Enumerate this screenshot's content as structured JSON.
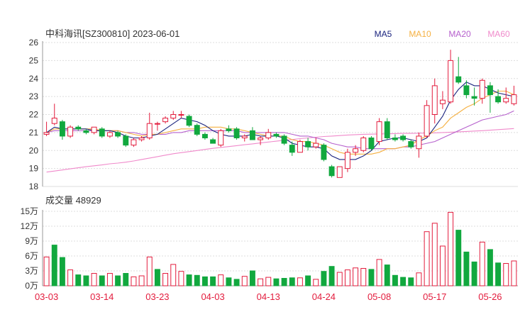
{
  "header": {
    "title": "中科海讯[SZ300810] 2023-06-01",
    "ma_legend": [
      {
        "label": "MA5",
        "color": "#1a237e"
      },
      {
        "label": "MA10",
        "color": "#f5b041"
      },
      {
        "label": "MA20",
        "color": "#b660cd"
      },
      {
        "label": "MA60",
        "color": "#f08acb"
      }
    ]
  },
  "volume_header": {
    "label": "成交量 48929"
  },
  "colors": {
    "up": "#e31c3d",
    "down": "#11a83e",
    "grid": "#dddddd",
    "axis": "#333333",
    "date_label": "#e31c3d"
  },
  "chart_data": [
    {
      "type": "candlestick",
      "title": "中科海讯[SZ300810] 2023-06-01",
      "ylim": [
        18,
        26
      ],
      "y_ticks": [
        "18",
        "19",
        "20",
        "21",
        "22",
        "23",
        "24",
        "25",
        "26"
      ],
      "x_tick_labels": [
        "03-03",
        "03-14",
        "03-23",
        "04-03",
        "04-13",
        "04-24",
        "05-08",
        "05-17",
        "05-26"
      ],
      "x_tick_indices": [
        0,
        7,
        14,
        21,
        28,
        35,
        42,
        49,
        56
      ],
      "ohlc": [
        [
          20.9,
          21.6,
          20.8,
          21.0
        ],
        [
          21.5,
          22.6,
          21.4,
          21.8
        ],
        [
          21.6,
          21.7,
          20.6,
          20.8
        ],
        [
          20.8,
          21.4,
          20.7,
          21.3
        ],
        [
          21.3,
          21.4,
          21.1,
          21.2
        ],
        [
          21.1,
          21.2,
          20.9,
          21.0
        ],
        [
          21.0,
          21.3,
          20.9,
          21.3
        ],
        [
          21.2,
          21.3,
          20.7,
          20.8
        ],
        [
          20.8,
          21.1,
          20.7,
          21.0
        ],
        [
          21.0,
          21.1,
          20.7,
          20.8
        ],
        [
          20.8,
          20.9,
          20.2,
          20.3
        ],
        [
          20.3,
          20.7,
          20.2,
          20.6
        ],
        [
          20.6,
          20.8,
          20.5,
          20.7
        ],
        [
          20.7,
          22.1,
          20.6,
          21.5
        ],
        [
          21.5,
          21.6,
          21.1,
          21.5
        ],
        [
          21.6,
          21.9,
          21.5,
          21.8
        ],
        [
          21.8,
          22.2,
          21.7,
          22.0
        ],
        [
          22.0,
          22.2,
          21.8,
          22.0
        ],
        [
          21.9,
          22.0,
          21.3,
          21.4
        ],
        [
          21.4,
          21.5,
          20.8,
          20.9
        ],
        [
          20.9,
          21.0,
          20.6,
          20.7
        ],
        [
          20.6,
          20.7,
          20.4,
          20.4
        ],
        [
          20.3,
          21.2,
          20.2,
          21.1
        ],
        [
          21.2,
          21.4,
          21.0,
          21.1
        ],
        [
          21.2,
          21.3,
          20.6,
          20.7
        ],
        [
          20.7,
          20.9,
          20.5,
          20.8
        ],
        [
          21.1,
          21.3,
          20.6,
          20.6
        ],
        [
          20.6,
          20.8,
          20.3,
          20.7
        ],
        [
          20.7,
          21.2,
          20.6,
          21.0
        ],
        [
          20.9,
          21.0,
          20.7,
          20.8
        ],
        [
          20.8,
          20.9,
          20.3,
          20.4
        ],
        [
          20.3,
          20.5,
          19.7,
          19.9
        ],
        [
          19.9,
          20.6,
          19.9,
          20.5
        ],
        [
          20.5,
          20.7,
          20.0,
          20.2
        ],
        [
          20.2,
          20.7,
          20.1,
          20.4
        ],
        [
          20.3,
          20.4,
          19.4,
          19.5
        ],
        [
          19.1,
          19.2,
          18.5,
          18.6
        ],
        [
          18.5,
          19.1,
          18.5,
          19.1
        ],
        [
          19.0,
          20.1,
          18.8,
          19.9
        ],
        [
          19.9,
          20.3,
          19.7,
          20.1
        ],
        [
          20.0,
          20.8,
          19.9,
          20.7
        ],
        [
          20.7,
          20.8,
          20.0,
          20.1
        ],
        [
          20.5,
          21.8,
          20.3,
          21.6
        ],
        [
          21.6,
          21.8,
          20.6,
          20.7
        ],
        [
          20.7,
          20.9,
          20.5,
          20.6
        ],
        [
          20.8,
          20.9,
          20.5,
          20.6
        ],
        [
          20.5,
          20.6,
          20.1,
          20.2
        ],
        [
          20.1,
          21.0,
          19.6,
          20.8
        ],
        [
          20.8,
          22.8,
          20.7,
          22.5
        ],
        [
          22.0,
          24.0,
          21.5,
          23.6
        ],
        [
          22.6,
          23.3,
          22.3,
          22.8
        ],
        [
          22.7,
          25.6,
          22.6,
          25.0
        ],
        [
          24.1,
          25.2,
          23.7,
          23.8
        ],
        [
          23.6,
          23.9,
          22.9,
          23.1
        ],
        [
          23.0,
          23.5,
          22.5,
          22.9
        ],
        [
          22.9,
          24.0,
          22.6,
          23.9
        ],
        [
          23.6,
          23.8,
          22.1,
          23.1
        ],
        [
          23.0,
          23.4,
          22.6,
          22.7
        ],
        [
          22.7,
          23.5,
          22.6,
          22.9
        ],
        [
          22.6,
          23.6,
          22.5,
          23.1
        ]
      ],
      "series": [
        {
          "name": "MA5",
          "color": "#1a237e",
          "values": [
            21.0,
            21.3,
            21.2,
            21.2,
            21.2,
            21.2,
            21.1,
            21.1,
            21.1,
            21.0,
            20.8,
            20.7,
            20.7,
            20.8,
            20.9,
            21.2,
            21.5,
            21.8,
            21.7,
            21.6,
            21.4,
            21.1,
            20.9,
            20.8,
            20.8,
            20.8,
            20.9,
            20.8,
            20.8,
            20.8,
            20.7,
            20.4,
            20.3,
            20.2,
            20.2,
            20.1,
            19.7,
            19.5,
            19.5,
            19.5,
            19.7,
            20.0,
            20.5,
            20.6,
            20.7,
            20.7,
            20.6,
            20.5,
            20.7,
            21.3,
            21.9,
            22.8,
            23.4,
            23.8,
            23.6,
            23.6,
            23.4,
            23.2,
            23.1,
            23.0
          ]
        },
        {
          "name": "MA10",
          "color": "#f5b041",
          "values": [
            21.0,
            21.2,
            21.2,
            21.2,
            21.2,
            21.2,
            21.2,
            21.1,
            21.1,
            21.1,
            21.0,
            20.9,
            20.8,
            20.9,
            20.9,
            21.0,
            21.1,
            21.2,
            21.2,
            21.2,
            21.3,
            21.3,
            21.3,
            21.2,
            21.2,
            21.1,
            21.0,
            20.9,
            20.8,
            20.8,
            20.8,
            20.6,
            20.5,
            20.5,
            20.4,
            20.3,
            20.1,
            19.9,
            19.8,
            19.8,
            19.8,
            19.8,
            19.9,
            20.1,
            20.1,
            20.2,
            20.3,
            20.6,
            20.8,
            21.1,
            21.3,
            21.8,
            22.1,
            22.4,
            22.6,
            22.9,
            23.1,
            23.3,
            23.3,
            23.1
          ]
        },
        {
          "name": "MA20",
          "color": "#b660cd",
          "values": [
            21.0,
            21.1,
            21.1,
            21.1,
            21.1,
            21.1,
            21.1,
            21.1,
            21.1,
            21.1,
            21.0,
            21.0,
            20.9,
            20.9,
            20.9,
            20.9,
            21.0,
            21.0,
            21.1,
            21.1,
            21.1,
            21.1,
            21.1,
            21.1,
            21.1,
            21.0,
            21.0,
            21.0,
            21.0,
            21.0,
            21.0,
            20.9,
            20.8,
            20.8,
            20.7,
            20.6,
            20.4,
            20.3,
            20.2,
            20.2,
            20.1,
            20.1,
            20.1,
            20.1,
            20.1,
            20.2,
            20.2,
            20.3,
            20.4,
            20.5,
            20.7,
            20.9,
            21.1,
            21.3,
            21.5,
            21.7,
            21.8,
            21.9,
            22.0,
            22.2
          ]
        },
        {
          "name": "MA60",
          "color": "#f08acb",
          "values": [
            18.8,
            18.86,
            18.92,
            18.98,
            19.04,
            19.1,
            19.15,
            19.2,
            19.26,
            19.3,
            19.35,
            19.42,
            19.5,
            19.58,
            19.66,
            19.74,
            19.82,
            19.88,
            19.94,
            20.0,
            20.06,
            20.12,
            20.17,
            20.22,
            20.27,
            20.32,
            20.37,
            20.42,
            20.47,
            20.52,
            20.57,
            20.61,
            20.66,
            20.7,
            20.74,
            20.78,
            20.8,
            20.83,
            20.86,
            20.88,
            20.9,
            20.91,
            20.92,
            20.93,
            20.94,
            20.95,
            20.95,
            20.96,
            20.97,
            20.98,
            21.0,
            21.02,
            21.04,
            21.06,
            21.08,
            21.1,
            21.13,
            21.16,
            21.19,
            21.22
          ]
        }
      ]
    },
    {
      "type": "bar",
      "title": "成交量 48929",
      "ylim": [
        0,
        15
      ],
      "y_ticks": [
        "0万",
        "3万",
        "6万",
        "9万",
        "12万",
        "15万"
      ],
      "unit": "万",
      "values": [
        5.8,
        8.2,
        5.7,
        3.2,
        2.2,
        2.0,
        2.5,
        2.0,
        2.5,
        2.0,
        2.5,
        1.8,
        2.0,
        5.8,
        3.3,
        2.5,
        4.3,
        2.9,
        2.2,
        2.1,
        1.8,
        1.8,
        2.2,
        1.6,
        1.3,
        1.9,
        3.0,
        1.4,
        1.7,
        1.4,
        1.5,
        1.6,
        1.6,
        2.0,
        1.3,
        2.9,
        3.9,
        2.7,
        3.2,
        3.6,
        3.5,
        3.3,
        5.3,
        4.2,
        2.1,
        1.7,
        1.6,
        2.6,
        10.9,
        12.6,
        8.0,
        14.8,
        11.2,
        6.8,
        4.8,
        8.8,
        7.3,
        4.6,
        4.5,
        5.0
      ],
      "colors_by_direction": [
        "up",
        "down",
        "down",
        "up",
        "down",
        "down",
        "up",
        "down",
        "up",
        "down",
        "down",
        "up",
        "up",
        "up",
        "down",
        "up",
        "up",
        "up",
        "down",
        "down",
        "down",
        "down",
        "up",
        "down",
        "down",
        "up",
        "down",
        "up",
        "up",
        "down",
        "down",
        "down",
        "up",
        "down",
        "up",
        "down",
        "down",
        "up",
        "up",
        "up",
        "up",
        "down",
        "up",
        "down",
        "down",
        "down",
        "down",
        "up",
        "up",
        "up",
        "up",
        "up",
        "down",
        "down",
        "down",
        "up",
        "down",
        "down",
        "up",
        "up"
      ]
    }
  ]
}
